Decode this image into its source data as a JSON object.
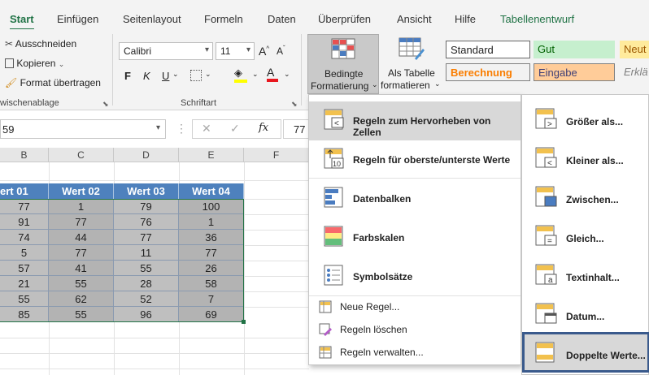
{
  "tabs": [
    "Start",
    "Einfügen",
    "Seitenlayout",
    "Formeln",
    "Daten",
    "Überprüfen",
    "Ansicht",
    "Hilfe",
    "Tabellenentwurf"
  ],
  "clipboard": {
    "cut": "Ausschneiden",
    "copy": "Kopieren",
    "format_painter": "Format übertragen",
    "group": "wischenablage"
  },
  "font": {
    "name": "Calibri",
    "size": "11",
    "bold": "F",
    "italic": "K",
    "underline": "U",
    "group": "Schriftart"
  },
  "cond_format": {
    "line1": "Bedingte",
    "line2": "Formatierung"
  },
  "as_table": {
    "line1": "Als Tabelle",
    "line2": "formatieren"
  },
  "styles": {
    "standard": "Standard",
    "gut": "Gut",
    "neutral": "Neut",
    "berechnung": "Berechnung",
    "eingabe": "Eingabe",
    "erklaer": "Erklä"
  },
  "formula_bar": {
    "namebox": "59",
    "value": "77",
    "fx": "fx"
  },
  "columns": [
    "B",
    "C",
    "D",
    "E",
    "F"
  ],
  "table": {
    "headers": [
      "ert 01",
      "Wert 02",
      "Wert 03",
      "Wert 04"
    ],
    "rows": [
      [
        "77",
        "1",
        "79",
        "100"
      ],
      [
        "91",
        "77",
        "76",
        "1"
      ],
      [
        "74",
        "44",
        "77",
        "36"
      ],
      [
        "5",
        "77",
        "11",
        "77"
      ],
      [
        "57",
        "41",
        "55",
        "26"
      ],
      [
        "21",
        "55",
        "28",
        "58"
      ],
      [
        "55",
        "62",
        "52",
        "7"
      ],
      [
        "85",
        "55",
        "96",
        "69"
      ]
    ]
  },
  "menu": {
    "highlight": "Regeln zum Hervorheben von Zellen",
    "topbottom": "Regeln für oberste/unterste Werte",
    "databars": "Datenbalken",
    "colorscales": "Farbskalen",
    "iconsets": "Symbolsätze",
    "new_rule": "Neue Regel...",
    "clear_rules": "Regeln löschen",
    "manage_rules": "Regeln verwalten..."
  },
  "submenu": {
    "greater": "Größer als...",
    "less": "Kleiner als...",
    "between": "Zwischen...",
    "equal": "Gleich...",
    "text_contains": "Textinhalt...",
    "date": "Datum...",
    "duplicate": "Doppelte Werte..."
  },
  "colors": {
    "accent": "#217346",
    "table_header": "#4e81bd",
    "table_body": "#b3b3b3",
    "selection_border": "#3a5a8c"
  }
}
